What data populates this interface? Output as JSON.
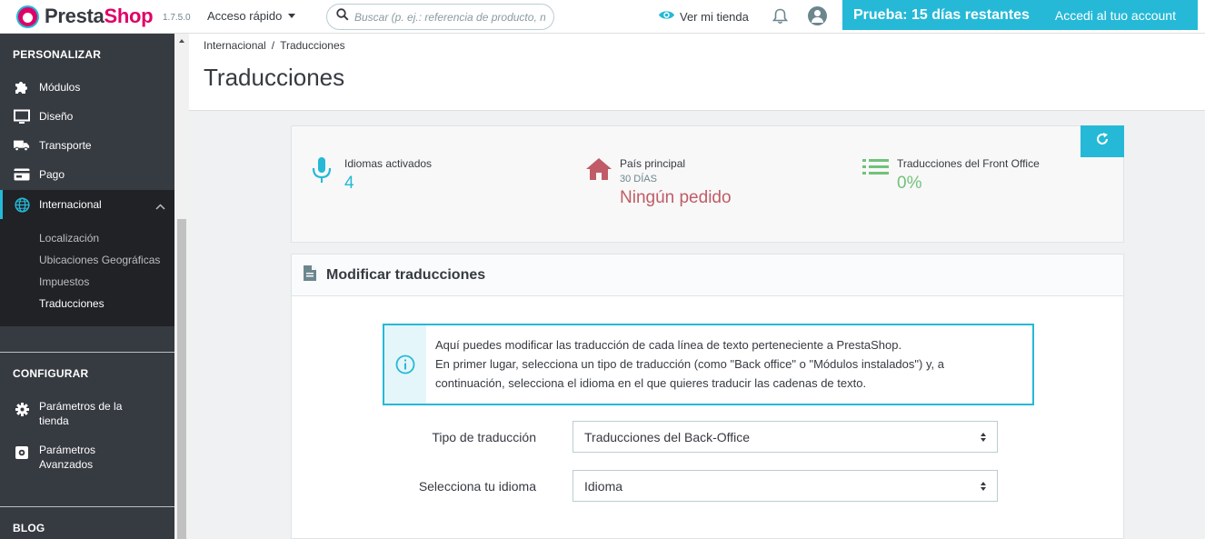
{
  "header": {
    "logo_prefix": "Presta",
    "logo_suffix": "Shop",
    "version": "1.7.5.0",
    "quick_access": "Acceso rápido",
    "search_placeholder": "Buscar (p. ej.: referencia de producto, n",
    "view_store": "Ver mi tienda",
    "trial_title": "Prueba: 15 días restantes",
    "trial_link": "Accedi al tuo account"
  },
  "sidebar": {
    "section_personalizar": "PERSONALIZAR",
    "items": [
      {
        "label": "Módulos",
        "icon": "puzzle-icon"
      },
      {
        "label": "Diseño",
        "icon": "monitor-icon"
      },
      {
        "label": "Transporte",
        "icon": "truck-icon"
      },
      {
        "label": "Pago",
        "icon": "credit-card-icon"
      },
      {
        "label": "Internacional",
        "icon": "globe-icon"
      }
    ],
    "submenu": [
      "Localización",
      "Ubicaciones Geográficas",
      "Impuestos",
      "Traducciones"
    ],
    "section_configurar": "CONFIGURAR",
    "config_items": [
      {
        "label": "Parámetros de la tienda",
        "icon": "gear-icon"
      },
      {
        "label": "Parámetros Avanzados",
        "icon": "advanced-settings-icon"
      }
    ],
    "section_blog": "BLOG"
  },
  "breadcrumb": [
    "Internacional",
    "/",
    "Traducciones"
  ],
  "page_title": "Traducciones",
  "kpi": {
    "languages_label": "Idiomas activados",
    "languages_value": "4",
    "country_label": "País principal",
    "country_sub": "30 DÍAS",
    "country_value": "Ningún pedido",
    "front_label": "Traducciones del Front Office",
    "front_value": "0%",
    "colors": {
      "blue": "#25b9d7",
      "red": "#c05c67",
      "green": "#72c279"
    }
  },
  "card": {
    "title": "Modificar traducciones",
    "alert_line1": "Aquí puedes modificar las traducción de cada línea de texto perteneciente a PrestaShop.",
    "alert_line2": "En primer lugar, selecciona un tipo de traducción (como \"Back office\" o \"Módulos instalados\") y, a",
    "alert_line3": "continuación, selecciona el idioma en el que quieres traducir las cadenas de texto.",
    "type_label": "Tipo de traducción",
    "type_value": "Traducciones del Back-Office",
    "lang_label": "Selecciona tu idioma",
    "lang_value": "Idioma"
  }
}
